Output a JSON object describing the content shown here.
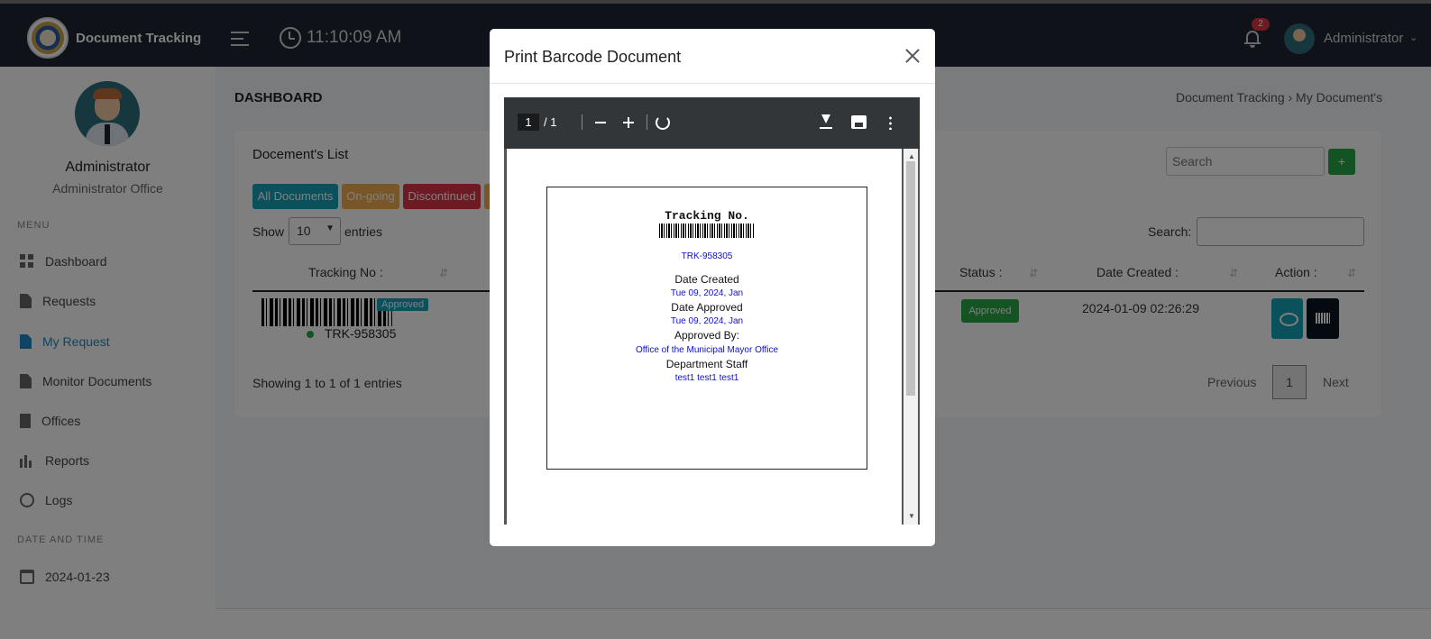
{
  "header": {
    "brand": "Document Tracking",
    "time": "11:10:09 AM",
    "notification_count": "2",
    "user": "Administrator"
  },
  "sidebar": {
    "name": "Administrator",
    "office": "Administrator Office",
    "menu_title": "MENU",
    "items": [
      {
        "label": "Dashboard",
        "icon": "dashboard-icon"
      },
      {
        "label": "Requests",
        "icon": "document-icon"
      },
      {
        "label": "My Request",
        "icon": "document-icon"
      },
      {
        "label": "Monitor Documents",
        "icon": "document-icon"
      },
      {
        "label": "Offices",
        "icon": "building-icon"
      },
      {
        "label": "Reports",
        "icon": "bar-chart-icon"
      },
      {
        "label": "Logs",
        "icon": "history-icon"
      }
    ],
    "date_title": "DATE AND TIME",
    "date": "2024-01-23"
  },
  "main": {
    "page_title": "DASHBOARD",
    "breadcrumb": "Document Tracking  ›  My Document's",
    "card_title": "Docement's List",
    "search_placeholder": "Search",
    "add_label": "+",
    "filters": [
      {
        "label": "All Documents",
        "color": "#17a2b8"
      },
      {
        "label": "On-going",
        "color": "#f0ad4e"
      },
      {
        "label": "Discontinued",
        "color": "#dc3545"
      }
    ],
    "show_label": "Show",
    "entries_value": "10",
    "entries_label": "entries",
    "search_label": "Search:",
    "columns": {
      "tracking": "Tracking No :",
      "status": "Status :",
      "date_created": "Date Created :",
      "action": "Action :"
    },
    "row": {
      "tag": "Approved",
      "tracking_no": "TRK-958305",
      "status": "Approved",
      "date_created": "2024-01-09 02:26:29"
    },
    "showing": "Showing 1 to 1 of 1 entries",
    "prev": "Previous",
    "page": "1",
    "next": "Next"
  },
  "modal": {
    "title": "Print Barcode Document",
    "viewer": {
      "page_current": "1",
      "page_total": "/  1"
    },
    "slip": {
      "heading": "Tracking No.",
      "tracking_no": "TRK-958305",
      "date_created_label": "Date Created",
      "date_created": "Tue 09, 2024, Jan",
      "date_approved_label": "Date Approved",
      "date_approved": "Tue 09, 2024, Jan",
      "approved_by_label": "Approved By:",
      "approved_by": "Office of the Municipal Mayor Office",
      "staff_label": "Department Staff",
      "staff": "test1 test1 test1"
    }
  }
}
